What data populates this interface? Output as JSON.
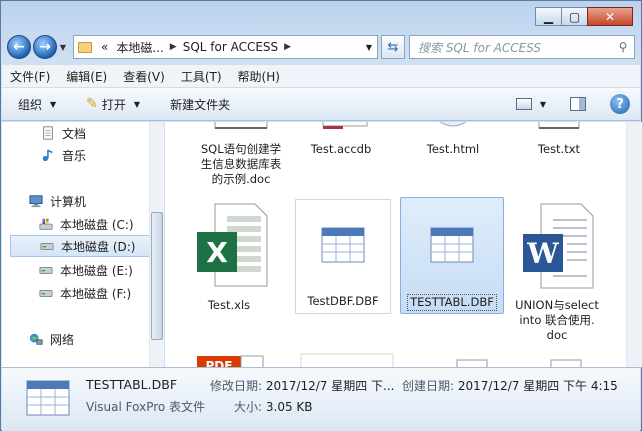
{
  "address": {
    "crumbs": [
      "本地磁...",
      "SQL for ACCESS"
    ],
    "back_glyph": "«"
  },
  "search": {
    "placeholder": "搜索 SQL for ACCESS"
  },
  "menubar": [
    "文件(F)",
    "编辑(E)",
    "查看(V)",
    "工具(T)",
    "帮助(H)"
  ],
  "toolbar": {
    "organize": "组织",
    "open": "打开",
    "new_folder": "新建文件夹"
  },
  "nav": {
    "items": [
      {
        "label": "文档",
        "icon": "documents-icon"
      },
      {
        "label": "音乐",
        "icon": "music-icon"
      },
      {
        "label": "计算机",
        "icon": "computer-icon"
      },
      {
        "label": "本地磁盘 (C:)",
        "icon": "windows-drive-icon"
      },
      {
        "label": "本地磁盘 (D:)",
        "icon": "drive-icon"
      },
      {
        "label": "本地磁盘 (E:)",
        "icon": "drive-icon"
      },
      {
        "label": "本地磁盘 (F:)",
        "icon": "drive-icon"
      },
      {
        "label": "网络",
        "icon": "network-icon"
      }
    ]
  },
  "files": [
    {
      "name": "SQL语句创建学生信息数据库表的示例.doc",
      "lines": [
        "SQL语句创建学",
        "生信息数据库表",
        "的示例.doc"
      ],
      "icon": "word-doc-icon"
    },
    {
      "name": "Test.accdb",
      "lines": [
        "Test.accdb"
      ],
      "icon": "access-db-icon"
    },
    {
      "name": "Test.html",
      "lines": [
        "Test.html"
      ],
      "icon": "html-file-icon"
    },
    {
      "name": "Test.txt",
      "lines": [
        "Test.txt"
      ],
      "icon": "text-file-icon"
    },
    {
      "name": "Test.xls",
      "lines": [
        "Test.xls"
      ],
      "icon": "excel-file-icon"
    },
    {
      "name": "TestDBF.DBF",
      "lines": [
        "TestDBF.DBF"
      ],
      "icon": "dbf-file-icon"
    },
    {
      "name": "TESTTABL.DBF",
      "lines": [
        "TESTTABL.DBF"
      ],
      "icon": "dbf-file-icon"
    },
    {
      "name": "UNION与select into 联合使用.doc",
      "lines": [
        "UNION与select",
        "into 联合使用.",
        "doc"
      ],
      "icon": "word-doc-icon"
    },
    {
      "name": "",
      "lines": [],
      "icon": "pdf-file-icon"
    }
  ],
  "details": {
    "name": "TESTTABL.DBF",
    "type": "Visual FoxPro 表文件",
    "modified_label": "修改日期:",
    "modified_value": "2017/12/7 星期四 下...",
    "created_label": "创建日期:",
    "created_value": "2017/12/7 星期四 下午 4:15",
    "size_label": "大小:",
    "size_value": "3.05 KB"
  },
  "colors": {
    "excel": "#1e7145",
    "word": "#2b5797",
    "pdf": "#d83b01",
    "selection": "#c6dcf5"
  }
}
